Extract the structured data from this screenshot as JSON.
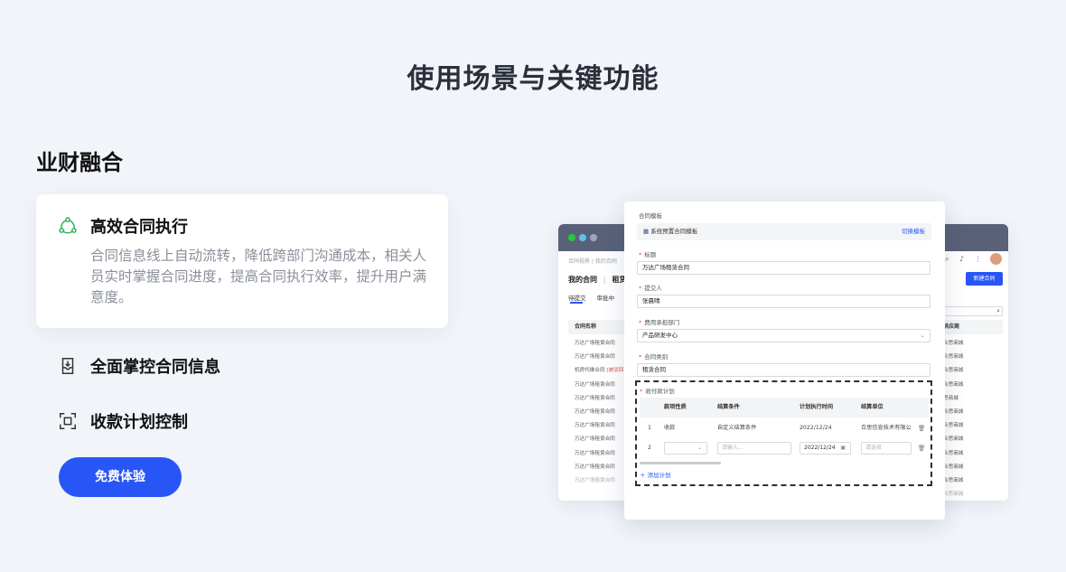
{
  "page": {
    "title": "使用场景与关键功能"
  },
  "section": {
    "title": "业财融合"
  },
  "features": [
    {
      "title": "高效合同执行",
      "desc": "合同信息线上自动流转，降低跨部门沟通成本，相关人员实时掌握合同进度，提高合同执行效率，提升用户满意度。",
      "icon": "cycle-icon"
    },
    {
      "title": "全面掌控合同信息",
      "icon": "inbox-download-icon"
    },
    {
      "title": "收款计划控制",
      "icon": "scan-frame-icon"
    }
  ],
  "cta": {
    "label": "免费体验"
  },
  "colors": {
    "accent": "#2856f6",
    "green_icon": "#2bb35a",
    "window_bar": "#596178"
  },
  "back_window": {
    "breadcrumb": "合同视界 / 我的合同",
    "heading_a": "我的合同",
    "heading_b": "租赁",
    "tabs": [
      "待提交",
      "审批中"
    ],
    "column_name": "合同名称",
    "rows": [
      "万达广场租赁合同",
      "万达广场租赁合同",
      "机房代维合同",
      "万达广场租赁合同",
      "万达广场租赁合同",
      "万达广场租赁合同",
      "万达广场租赁合同",
      "万达广场租赁合同",
      "万达广场租赁合同",
      "万达广场租赁合同",
      "万达广场租赁合同"
    ],
    "row3_tag": "[被驳回]",
    "new_button": "新建合同",
    "column_supplier": "供应商",
    "supplier_rows": [
      "合思商城",
      "合思商城",
      "合思商城",
      "合思商城",
      "思商城",
      "合思商城",
      "合思商城",
      "合思商城",
      "合思商城",
      "合思商城",
      "合思商城",
      "合思商城"
    ],
    "supplier_row4_full": "合思商城",
    "search_icon": "search-icon"
  },
  "front_window": {
    "template_label": "合同模板",
    "template_value": "系统预置合同模板",
    "template_switch": "切换模板",
    "title_label": "标题",
    "title_value": "万达广场租赁合同",
    "submitter_label": "提交人",
    "submitter_value": "张晨晴",
    "dept_label": "费用承担部门",
    "dept_value": "产品研发中心",
    "type_label": "合同类别",
    "type_value": "租赁合同",
    "plan_label": "收付款计划",
    "plan_columns": [
      "款项性质",
      "结算条件",
      "计划执行时间",
      "结算单位"
    ],
    "plan_rows": [
      {
        "no": "1",
        "nature": "收款",
        "condition": "自定义结算条件",
        "date": "2022/12/24",
        "unit": "合思信息技术有限公"
      },
      {
        "no": "2",
        "nature": "",
        "condition_placeholder": "请输入...",
        "date": "2022/12/24",
        "unit_placeholder": "请选择"
      }
    ],
    "add_plan": "添加计划"
  }
}
